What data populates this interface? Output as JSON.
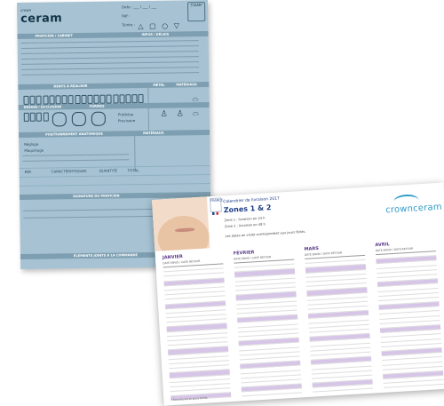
{
  "back_form": {
    "logo": "ceram",
    "logo_small": "crown",
    "date_label": "Date : ___ / ___ / ___",
    "ref_label": "Réf :",
    "teinte_label": "Teinte :",
    "shapes": "△ ▢ ○ ▽",
    "stamp": "STAMP",
    "section_1": "PRATICIEN / CABINET",
    "section_1_right": "INFOS / DÉLAIS",
    "section_2": "DENTS À RÉALISER",
    "section_2_mid": "MÉTAL",
    "section_2_right": "MATÉRIAUX",
    "section_3": "DESIGN / OCCLUSION",
    "section_4": "FORMES",
    "section_5": "POSITIONNEMENT ANATOMIQUE",
    "section_6": "SIGNATURE DU PRATICIEN",
    "section_7": "ÉLÉMENTS JOINTS À LA COMMANDE",
    "check_labels": [
      "Prothèse",
      "Provisoire",
      "Réglage",
      "Maquillage"
    ],
    "table_headers": [
      "RÉF.",
      "CARACTÉRISTIQUES",
      "QUANTITÉ",
      "TOTAL"
    ]
  },
  "front_page": {
    "title": "Calendrier de livraison 2017",
    "zones": "Zones 1 & 2",
    "brand": "crownceram",
    "badge": "FRANCE",
    "note_1": "Zone 1 : livraison en 24 h",
    "note_2": "Zone 2 : livraison en 48 h",
    "note_3": "Les dates en violet correspondent aux jours fériés.",
    "months": [
      "JANVIER",
      "FÉVRIER",
      "MARS",
      "AVRIL"
    ],
    "col_header": "DATE ENVOI / DATE RETOUR",
    "footer": "* Fermetures et jours fériés"
  }
}
